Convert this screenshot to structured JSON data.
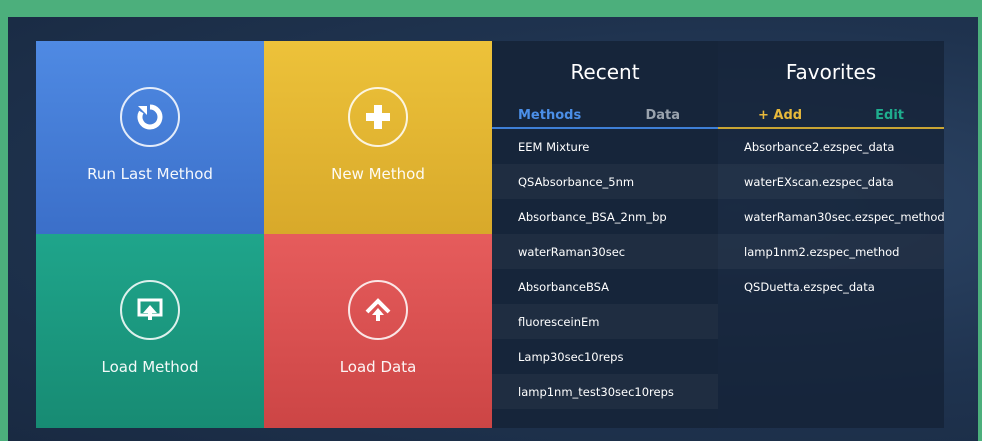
{
  "tiles": {
    "run_last": {
      "label": "Run Last Method",
      "icon": "refresh-icon",
      "color": "#4a82dc"
    },
    "new_method": {
      "label": "New Method",
      "icon": "plus-icon",
      "color": "#e6b934"
    },
    "load_method": {
      "label": "Load Method",
      "icon": "load-method-icon",
      "color": "#1b9b81"
    },
    "load_data": {
      "label": "Load Data",
      "icon": "upload-icon",
      "color": "#de5252"
    }
  },
  "recent": {
    "title": "Recent",
    "tabs": {
      "methods": "Methods",
      "data": "Data"
    },
    "items": [
      "EEM Mixture",
      "QSAbsorbance_5nm",
      "Absorbance_BSA_2nm_bp",
      "waterRaman30sec",
      "AbsorbanceBSA",
      "fluoresceinEm",
      "Lamp30sec10reps",
      "lamp1nm_test30sec10reps"
    ]
  },
  "favorites": {
    "title": "Favorites",
    "tabs": {
      "add": "+ Add",
      "edit": "Edit"
    },
    "items": [
      "Absorbance2.ezspec_data",
      "waterEXscan.ezspec_data",
      "waterRaman30sec.ezspec_method",
      "lamp1nm2.ezspec_method",
      "QSDuetta.ezspec_data"
    ]
  }
}
